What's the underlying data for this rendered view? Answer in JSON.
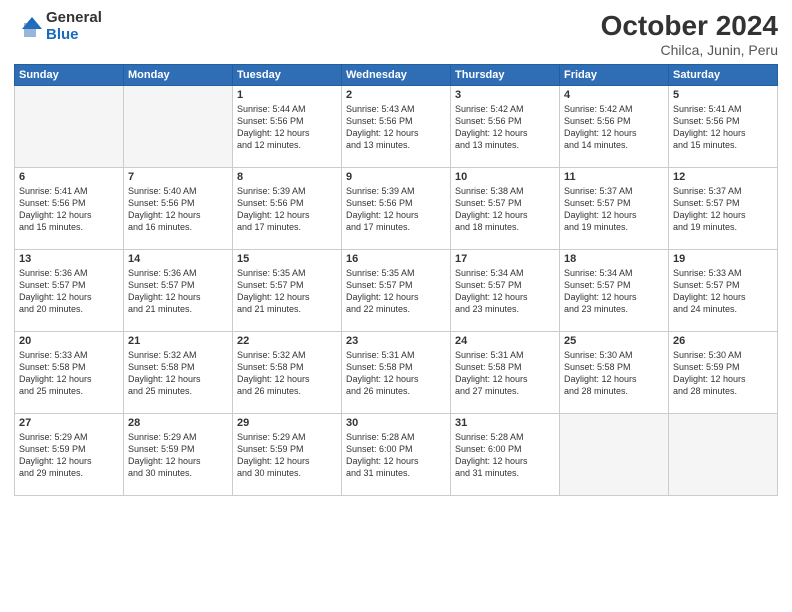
{
  "logo": {
    "general": "General",
    "blue": "Blue"
  },
  "header": {
    "month": "October 2024",
    "location": "Chilca, Junin, Peru"
  },
  "weekdays": [
    "Sunday",
    "Monday",
    "Tuesday",
    "Wednesday",
    "Thursday",
    "Friday",
    "Saturday"
  ],
  "weeks": [
    [
      {
        "day": "",
        "empty": true,
        "info": ""
      },
      {
        "day": "",
        "empty": true,
        "info": ""
      },
      {
        "day": "1",
        "empty": false,
        "info": "Sunrise: 5:44 AM\nSunset: 5:56 PM\nDaylight: 12 hours\nand 12 minutes."
      },
      {
        "day": "2",
        "empty": false,
        "info": "Sunrise: 5:43 AM\nSunset: 5:56 PM\nDaylight: 12 hours\nand 13 minutes."
      },
      {
        "day": "3",
        "empty": false,
        "info": "Sunrise: 5:42 AM\nSunset: 5:56 PM\nDaylight: 12 hours\nand 13 minutes."
      },
      {
        "day": "4",
        "empty": false,
        "info": "Sunrise: 5:42 AM\nSunset: 5:56 PM\nDaylight: 12 hours\nand 14 minutes."
      },
      {
        "day": "5",
        "empty": false,
        "info": "Sunrise: 5:41 AM\nSunset: 5:56 PM\nDaylight: 12 hours\nand 15 minutes."
      }
    ],
    [
      {
        "day": "6",
        "empty": false,
        "info": "Sunrise: 5:41 AM\nSunset: 5:56 PM\nDaylight: 12 hours\nand 15 minutes."
      },
      {
        "day": "7",
        "empty": false,
        "info": "Sunrise: 5:40 AM\nSunset: 5:56 PM\nDaylight: 12 hours\nand 16 minutes."
      },
      {
        "day": "8",
        "empty": false,
        "info": "Sunrise: 5:39 AM\nSunset: 5:56 PM\nDaylight: 12 hours\nand 17 minutes."
      },
      {
        "day": "9",
        "empty": false,
        "info": "Sunrise: 5:39 AM\nSunset: 5:56 PM\nDaylight: 12 hours\nand 17 minutes."
      },
      {
        "day": "10",
        "empty": false,
        "info": "Sunrise: 5:38 AM\nSunset: 5:57 PM\nDaylight: 12 hours\nand 18 minutes."
      },
      {
        "day": "11",
        "empty": false,
        "info": "Sunrise: 5:37 AM\nSunset: 5:57 PM\nDaylight: 12 hours\nand 19 minutes."
      },
      {
        "day": "12",
        "empty": false,
        "info": "Sunrise: 5:37 AM\nSunset: 5:57 PM\nDaylight: 12 hours\nand 19 minutes."
      }
    ],
    [
      {
        "day": "13",
        "empty": false,
        "info": "Sunrise: 5:36 AM\nSunset: 5:57 PM\nDaylight: 12 hours\nand 20 minutes."
      },
      {
        "day": "14",
        "empty": false,
        "info": "Sunrise: 5:36 AM\nSunset: 5:57 PM\nDaylight: 12 hours\nand 21 minutes."
      },
      {
        "day": "15",
        "empty": false,
        "info": "Sunrise: 5:35 AM\nSunset: 5:57 PM\nDaylight: 12 hours\nand 21 minutes."
      },
      {
        "day": "16",
        "empty": false,
        "info": "Sunrise: 5:35 AM\nSunset: 5:57 PM\nDaylight: 12 hours\nand 22 minutes."
      },
      {
        "day": "17",
        "empty": false,
        "info": "Sunrise: 5:34 AM\nSunset: 5:57 PM\nDaylight: 12 hours\nand 23 minutes."
      },
      {
        "day": "18",
        "empty": false,
        "info": "Sunrise: 5:34 AM\nSunset: 5:57 PM\nDaylight: 12 hours\nand 23 minutes."
      },
      {
        "day": "19",
        "empty": false,
        "info": "Sunrise: 5:33 AM\nSunset: 5:57 PM\nDaylight: 12 hours\nand 24 minutes."
      }
    ],
    [
      {
        "day": "20",
        "empty": false,
        "info": "Sunrise: 5:33 AM\nSunset: 5:58 PM\nDaylight: 12 hours\nand 25 minutes."
      },
      {
        "day": "21",
        "empty": false,
        "info": "Sunrise: 5:32 AM\nSunset: 5:58 PM\nDaylight: 12 hours\nand 25 minutes."
      },
      {
        "day": "22",
        "empty": false,
        "info": "Sunrise: 5:32 AM\nSunset: 5:58 PM\nDaylight: 12 hours\nand 26 minutes."
      },
      {
        "day": "23",
        "empty": false,
        "info": "Sunrise: 5:31 AM\nSunset: 5:58 PM\nDaylight: 12 hours\nand 26 minutes."
      },
      {
        "day": "24",
        "empty": false,
        "info": "Sunrise: 5:31 AM\nSunset: 5:58 PM\nDaylight: 12 hours\nand 27 minutes."
      },
      {
        "day": "25",
        "empty": false,
        "info": "Sunrise: 5:30 AM\nSunset: 5:58 PM\nDaylight: 12 hours\nand 28 minutes."
      },
      {
        "day": "26",
        "empty": false,
        "info": "Sunrise: 5:30 AM\nSunset: 5:59 PM\nDaylight: 12 hours\nand 28 minutes."
      }
    ],
    [
      {
        "day": "27",
        "empty": false,
        "info": "Sunrise: 5:29 AM\nSunset: 5:59 PM\nDaylight: 12 hours\nand 29 minutes."
      },
      {
        "day": "28",
        "empty": false,
        "info": "Sunrise: 5:29 AM\nSunset: 5:59 PM\nDaylight: 12 hours\nand 30 minutes."
      },
      {
        "day": "29",
        "empty": false,
        "info": "Sunrise: 5:29 AM\nSunset: 5:59 PM\nDaylight: 12 hours\nand 30 minutes."
      },
      {
        "day": "30",
        "empty": false,
        "info": "Sunrise: 5:28 AM\nSunset: 6:00 PM\nDaylight: 12 hours\nand 31 minutes."
      },
      {
        "day": "31",
        "empty": false,
        "info": "Sunrise: 5:28 AM\nSunset: 6:00 PM\nDaylight: 12 hours\nand 31 minutes."
      },
      {
        "day": "",
        "empty": true,
        "info": ""
      },
      {
        "day": "",
        "empty": true,
        "info": ""
      }
    ]
  ]
}
